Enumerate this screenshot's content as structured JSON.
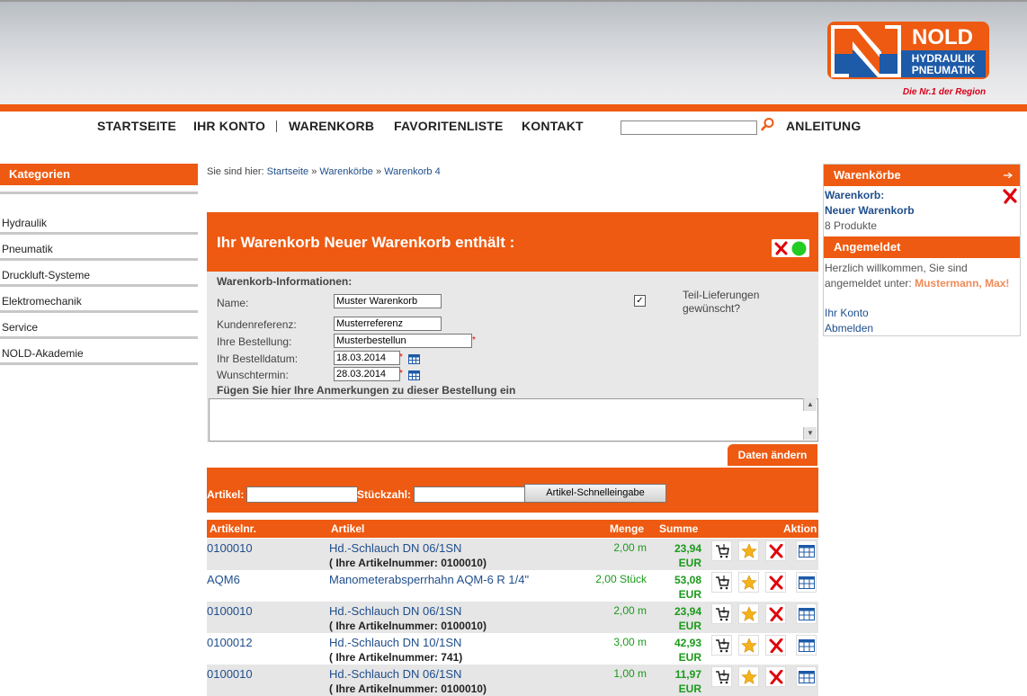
{
  "header": {
    "logo": {
      "brand": "NOLD",
      "line1": "HYDRAULIK",
      "line2": "PNEUMATIK",
      "slogan": "Die Nr.1 der Region"
    }
  },
  "nav": {
    "items": [
      "STARTSEITE",
      "IHR KONTO",
      "WARENKORB",
      "FAVORITENLISTE",
      "KONTAKT"
    ],
    "search_value": "",
    "help_label": "ANLEITUNG"
  },
  "sidebar": {
    "title": "Kategorien",
    "items": [
      "Hydraulik",
      "Pneumatik",
      "Druckluft-Systeme",
      "Elektromechanik",
      "Service",
      "NOLD-Akademie"
    ]
  },
  "breadcrumb": {
    "prefix": "Sie sind hier:",
    "links": [
      "Startseite",
      "Warenkörbe",
      "Warenkorb 4"
    ],
    "separator": "»"
  },
  "cart": {
    "title": "Ihr Warenkorb Neuer Warenkorb enthält :",
    "section_title": "Warenkorb-Informationen:",
    "labels": {
      "name": "Name:",
      "reference": "Kundenreferenz:",
      "order": "Ihre Bestellung:",
      "order_date": "Ihr Bestelldatum:",
      "wish_date": "Wunschtermin:"
    },
    "values": {
      "name": "Muster Warenkorb",
      "reference": "Musterreferenz",
      "order": "Musterbestellun",
      "order_date": "18.03.2014",
      "wish_date": "28.03.2014"
    },
    "partial_delivery_label": "Teil-Lieferungen gewünscht?",
    "partial_delivery_checked": "✓",
    "comment_label": "Fügen Sie hier Ihre Anmerkungen zu dieser Bestellung ein",
    "comment_value": "",
    "save_button": "Daten ändern",
    "required_mark": "*"
  },
  "quick_entry": {
    "article_label": "Artikel:",
    "qty_label": "Stückzahl:",
    "button": "Artikel-Schnelleingabe"
  },
  "table": {
    "columns": [
      "Artikelnr.",
      "Artikel",
      "Menge",
      "Summe",
      "Aktion"
    ],
    "rows": [
      {
        "nr": "0100010",
        "article": "Hd.-Schlauch DN 06/1SN",
        "sub": "( Ihre Artikelnummer: 0100010)",
        "qty": "2,00 m",
        "sum": "23,94",
        "cur": "EUR"
      },
      {
        "nr": "AQM6",
        "article": "Manometerabsperrhahn AQM-6 R 1/4\"",
        "sub": "",
        "qty": "2,00 Stück",
        "sum": "53,08",
        "cur": "EUR"
      },
      {
        "nr": "0100010",
        "article": "Hd.-Schlauch DN 06/1SN",
        "sub": "( Ihre Artikelnummer: 0100010)",
        "qty": "2,00 m",
        "sum": "23,94",
        "cur": "EUR"
      },
      {
        "nr": "0100012",
        "article": "Hd.-Schlauch DN 10/1SN",
        "sub": "( Ihre Artikelnummer: 741)",
        "qty": "3,00 m",
        "sum": "42,93",
        "cur": "EUR"
      },
      {
        "nr": "0100010",
        "article": "Hd.-Schlauch DN 06/1SN",
        "sub": "( Ihre Artikelnummer: 0100010)",
        "qty": "1,00 m",
        "sum": "11,97",
        "cur": "EUR"
      }
    ]
  },
  "right": {
    "carts_title": "Warenkörbe",
    "cart_label": "Warenkorb:",
    "cart_name": "Neuer Warenkorb",
    "cart_count": "8 Produkte",
    "login_title": "Angemeldet",
    "welcome_line1": "Herzlich willkommen, Sie sind",
    "welcome_line2": "angemeldet unter:",
    "user": "Mustermann, Max!",
    "account_link": "Ihr Konto",
    "logout_link": "Abmelden"
  },
  "colors": {
    "accent": "#ee5a11",
    "link": "#1f4e8c",
    "price": "#1a9a1a",
    "logo_blue": "#1d5aa8"
  },
  "icons": [
    "search-icon",
    "calendar-icon",
    "cart-icon",
    "star-icon",
    "delete-icon",
    "table-icon",
    "arrow-right-icon",
    "status-green-icon"
  ]
}
